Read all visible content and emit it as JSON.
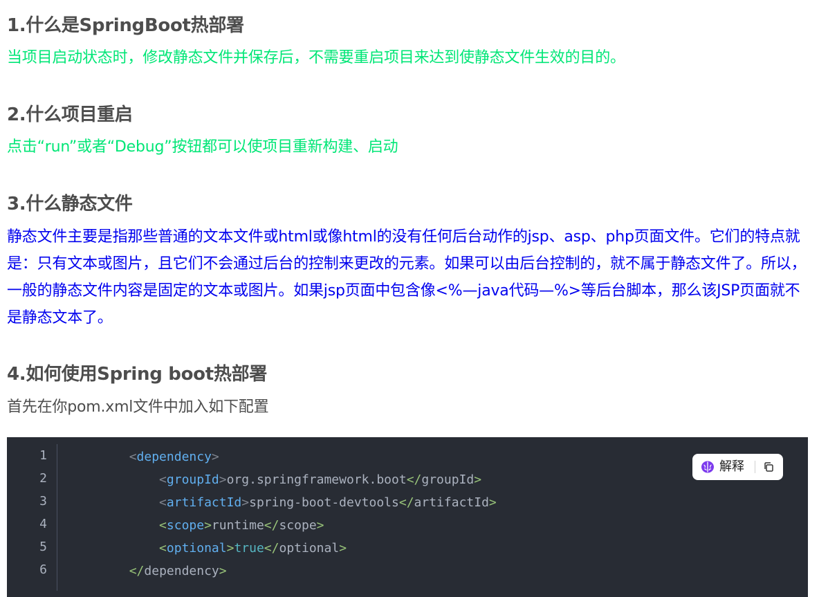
{
  "sections": [
    {
      "heading": "1.什么是SpringBoot热部署",
      "text": "当项目启动状态时，修改静态文件并保存后，不需要重启项目来达到使静态文件生效的目的。"
    },
    {
      "heading": "2.什么项目重启",
      "text": "点击“run”或者“Debug”按钮都可以使项目重新构建、启动"
    },
    {
      "heading": "3.什么静态文件",
      "text": "静态文件主要是指那些普通的文本文件或html或像html的没有任何后台动作的jsp、asp、php页面文件。它们的特点就是：只有文本或图片，且它们不会通过后台的控制来更改的元素。如果可以由后台控制的，就不属于静态文件了。所以，一般的静态文件内容是固定的文本或图片。如果jsp页面中包含像<%—java代码—%>等后台脚本，那么该JSP页面就不是静态文本了。"
    },
    {
      "heading": "4.如何使用Spring boot热部署",
      "text": "首先在你pom.xml文件中加入如下配置"
    }
  ],
  "code": {
    "line_numbers": [
      "1",
      "2",
      "3",
      "4",
      "5",
      "6"
    ],
    "lines": [
      {
        "indent": "        ",
        "open": "<",
        "tag": "dependency",
        "close": ">"
      },
      {
        "indent": "            ",
        "tag": "groupId",
        "value": "org.springframework.boot"
      },
      {
        "indent": "            ",
        "tag": "artifactId",
        "value": "spring-boot-devtools"
      },
      {
        "indent": "            ",
        "tag": "scope",
        "value": "runtime"
      },
      {
        "indent": "            ",
        "tag": "optional",
        "value": "true"
      },
      {
        "indent": "        ",
        "open": "</",
        "tag": "dependency",
        "close": ">"
      }
    ]
  },
  "toolbar": {
    "explain_label": "解释",
    "explain_icon": "brain-icon",
    "copy_icon": "copy-icon"
  },
  "colors": {
    "heading": "#4d4d4d",
    "green_text": "#00e676",
    "blue_text": "#0000ee",
    "code_bg": "#282c34",
    "code_tag": "#61afef",
    "code_keyword": "#56b6c2"
  }
}
